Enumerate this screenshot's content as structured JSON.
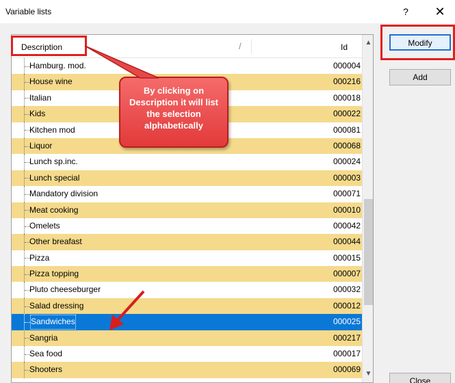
{
  "window": {
    "title": "Variable lists",
    "help": "?",
    "close": "✕"
  },
  "list": {
    "header": {
      "description": "Description",
      "sort_glyph": "/",
      "id": "Id"
    },
    "rows": [
      {
        "description": "Hamburg. mod.",
        "id": "000004",
        "shaded": false,
        "selected": false
      },
      {
        "description": "House wine",
        "id": "000216",
        "shaded": true,
        "selected": false
      },
      {
        "description": "Italian",
        "id": "000018",
        "shaded": false,
        "selected": false
      },
      {
        "description": "Kids",
        "id": "000022",
        "shaded": true,
        "selected": false
      },
      {
        "description": "Kitchen mod",
        "id": "000081",
        "shaded": false,
        "selected": false
      },
      {
        "description": "Liquor",
        "id": "000068",
        "shaded": true,
        "selected": false
      },
      {
        "description": "Lunch sp.inc.",
        "id": "000024",
        "shaded": false,
        "selected": false
      },
      {
        "description": "Lunch special",
        "id": "000003",
        "shaded": true,
        "selected": false
      },
      {
        "description": "Mandatory division",
        "id": "000071",
        "shaded": false,
        "selected": false
      },
      {
        "description": "Meat cooking",
        "id": "000010",
        "shaded": true,
        "selected": false
      },
      {
        "description": "Omelets",
        "id": "000042",
        "shaded": false,
        "selected": false
      },
      {
        "description": "Other breafast",
        "id": "000044",
        "shaded": true,
        "selected": false
      },
      {
        "description": "Pizza",
        "id": "000015",
        "shaded": false,
        "selected": false
      },
      {
        "description": "Pizza topping",
        "id": "000007",
        "shaded": true,
        "selected": false
      },
      {
        "description": "Pluto cheeseburger",
        "id": "000032",
        "shaded": false,
        "selected": false
      },
      {
        "description": "Salad dressing",
        "id": "000012",
        "shaded": true,
        "selected": false
      },
      {
        "description": "Sandwiches",
        "id": "000025",
        "shaded": false,
        "selected": true
      },
      {
        "description": "Sangria",
        "id": "000217",
        "shaded": true,
        "selected": false
      },
      {
        "description": "Sea food",
        "id": "000017",
        "shaded": false,
        "selected": false
      },
      {
        "description": "Shooters",
        "id": "000069",
        "shaded": true,
        "selected": false
      }
    ]
  },
  "buttons": {
    "modify": "Modify",
    "add": "Add",
    "close": "Close"
  },
  "callout": {
    "text": "By clicking on Description it will list the selection alphabetically"
  },
  "colors": {
    "row_shade": "#f5da8c",
    "selection": "#0a78d7",
    "highlight": "#e02020"
  }
}
